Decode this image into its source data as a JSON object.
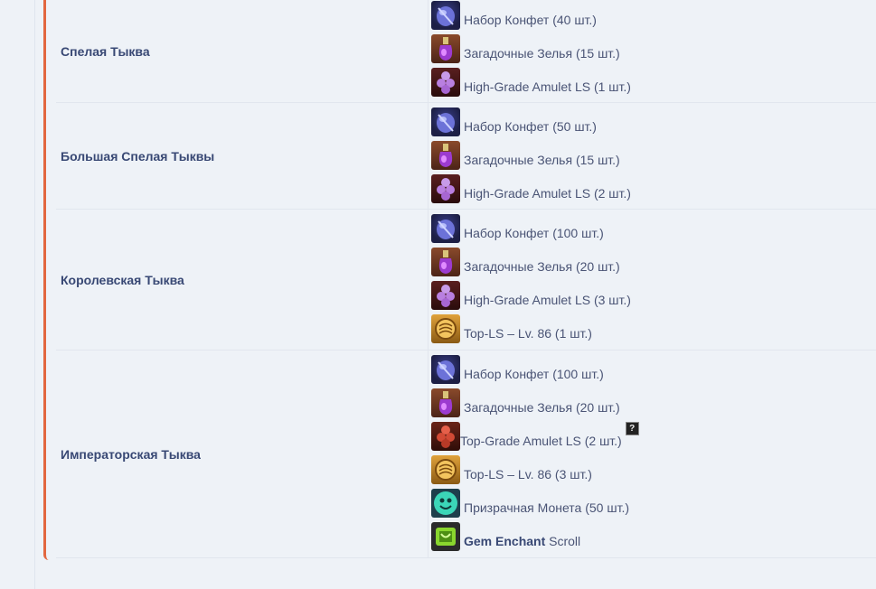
{
  "colors": {
    "accent": "#e2673f",
    "text": "#4a5475",
    "name_text": "#384874",
    "background": "#eef2f7"
  },
  "rows": [
    {
      "name": "Спелая Тыква",
      "items": [
        {
          "icon": "candy-bag-icon",
          "text": "Набор Конфет (40 шт.)"
        },
        {
          "icon": "potion-icon",
          "text": "Загадочные Зелья (15 шт.)"
        },
        {
          "icon": "amulet-icon",
          "text": "High-Grade Amulet LS (1 шт.)"
        }
      ]
    },
    {
      "name": "Большая Спелая Тыквы",
      "items": [
        {
          "icon": "candy-bag-icon",
          "text": "Набор Конфет (50 шт.)"
        },
        {
          "icon": "potion-icon",
          "text": "Загадочные Зелья (15 шт.)"
        },
        {
          "icon": "amulet-icon",
          "text": "High-Grade Amulet LS (2 шт.)"
        }
      ]
    },
    {
      "name": "Королевская Тыква",
      "items": [
        {
          "icon": "candy-bag-icon",
          "text": "Набор Конфет (100 шт.)"
        },
        {
          "icon": "potion-icon",
          "text": "Загадочные Зелья (20 шт.)"
        },
        {
          "icon": "amulet-icon",
          "text": "High-Grade Amulet LS (3 шт.)"
        },
        {
          "icon": "top-ls-icon",
          "text": "Top-LS – Lv. 86 (1 шт.)"
        }
      ]
    },
    {
      "name": "Императорская Тыква",
      "items": [
        {
          "icon": "candy-bag-icon",
          "text": "Набор Конфет (100 шт.)"
        },
        {
          "icon": "potion-icon",
          "text": "Загадочные Зелья (20 шт.)"
        },
        {
          "icon": "top-amulet-icon",
          "text": "Top-Grade Amulet LS (2 шт.)",
          "help": "?"
        },
        {
          "icon": "top-ls-icon",
          "text": "Top-LS – Lv. 86 (3 шт.)"
        },
        {
          "icon": "ghost-coin-icon",
          "text": "Призрачная Монета (50 шт.)"
        },
        {
          "icon": "gem-scroll-icon",
          "bold": "Gem Enchant",
          "text": " Scroll"
        }
      ]
    }
  ]
}
